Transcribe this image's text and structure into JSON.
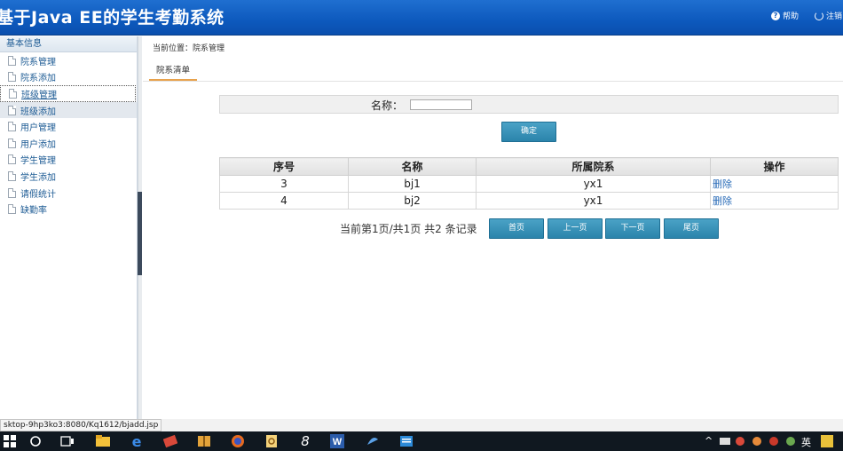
{
  "header": {
    "title": "基于Java EE的学生考勤系统",
    "help_label": "帮助",
    "logout_label": "注销"
  },
  "sidebar": {
    "group_label": "基本信息",
    "items": [
      {
        "label": "院系管理"
      },
      {
        "label": "院系添加"
      },
      {
        "label": "班级管理"
      },
      {
        "label": "班级添加"
      },
      {
        "label": "用户管理"
      },
      {
        "label": "用户添加"
      },
      {
        "label": "学生管理"
      },
      {
        "label": "学生添加"
      },
      {
        "label": "请假统计"
      },
      {
        "label": "缺勤率"
      }
    ]
  },
  "main": {
    "breadcrumb": "当前位置：院系管理",
    "tab_label": "院系清单",
    "search": {
      "label": "名称：",
      "value": ""
    },
    "confirm_button": "确定",
    "table": {
      "headers": [
        "序号",
        "名称",
        "所属院系",
        "操作"
      ],
      "rows": [
        {
          "id": "3",
          "name": "bj1",
          "dept": "yx1",
          "action": "删除"
        },
        {
          "id": "4",
          "name": "bj2",
          "dept": "yx1",
          "action": "删除"
        }
      ]
    },
    "pager": {
      "text": "当前第1页/共1页  共2 条记录",
      "first": "首页",
      "prev": "上一页",
      "next": "下一页",
      "last": "尾页"
    }
  },
  "statusbar": {
    "url": "sktop-9hp3ko3:8080/Kq1612/bjadd.jsp"
  },
  "taskbar": {
    "input_method": "英"
  },
  "colors": {
    "header_bg": "#0d59bd",
    "button_bg": "#3594bb",
    "link": "#2a6cb8",
    "tab_underline": "#e8a24c"
  }
}
